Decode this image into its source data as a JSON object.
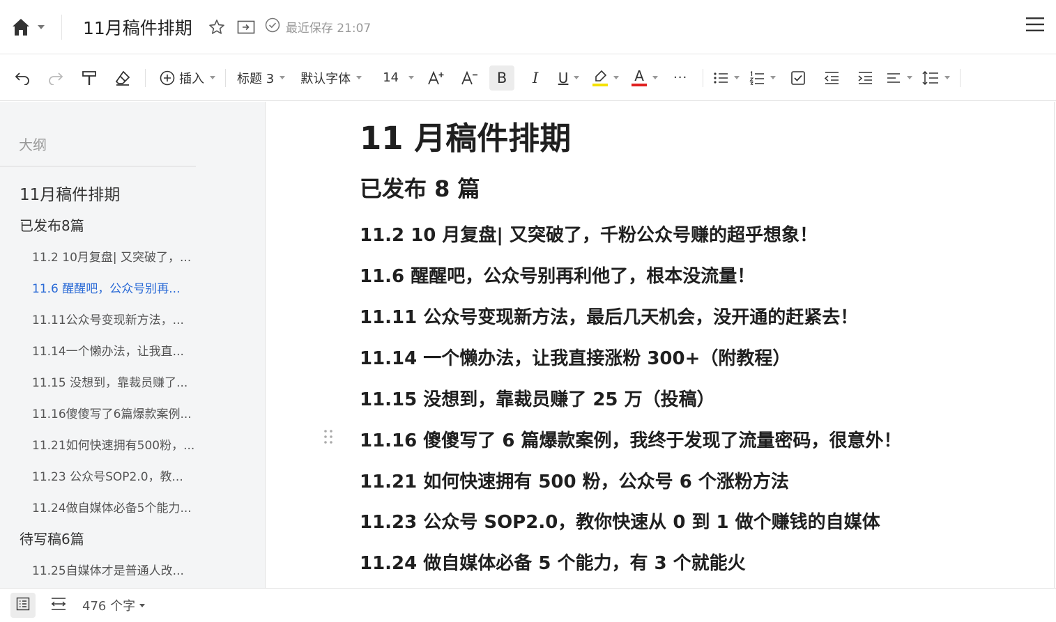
{
  "titlebar": {
    "doc_title": "11月稿件排期",
    "save_status": "最近保存 21:07"
  },
  "toolbar": {
    "insert_label": "插入",
    "heading_style": "标题 3",
    "font_family": "默认字体",
    "font_size": "14",
    "bold_glyph": "B",
    "italic_glyph": "I",
    "underline_glyph": "U",
    "font_color_glyph": "A",
    "more_glyph": "···",
    "highlight_color": "#f5e100",
    "font_color": "#e02020"
  },
  "sidebar": {
    "outline_label": "大纲",
    "items": [
      {
        "text": "11月稿件排期",
        "level": 1
      },
      {
        "text": "已发布8篇",
        "level": 2
      },
      {
        "text": "11.2  10月复盘|  又突破了，...",
        "level": 3
      },
      {
        "text": "11.6  醒醒吧，公众号别再...",
        "level": 3,
        "active": true
      },
      {
        "text": "11.11公众号变现新方法，...",
        "level": 3
      },
      {
        "text": "11.14一个懒办法，让我直...",
        "level": 3
      },
      {
        "text": "11.15  没想到，靠裁员赚了...",
        "level": 3
      },
      {
        "text": "11.16傻傻写了6篇爆款案例...",
        "level": 3
      },
      {
        "text": "11.21如何快速拥有500粉，...",
        "level": 3
      },
      {
        "text": "11.23  公众号SOP2.0，教...",
        "level": 3
      },
      {
        "text": "11.24做自媒体必备5个能力...",
        "level": 3
      },
      {
        "text": "待写稿6篇",
        "level": 2
      },
      {
        "text": "11.25自媒体才是普通人改...",
        "level": 3
      }
    ]
  },
  "editor": {
    "lines": [
      {
        "text": "11 月稿件排期",
        "level": 1
      },
      {
        "text": "已发布 8 篇",
        "level": 2
      },
      {
        "text": "11.2 10 月复盘| 又突破了，千粉公众号赚的超乎想象！",
        "level": 3
      },
      {
        "text": "11.6 醒醒吧，公众号别再利他了，根本没流量！",
        "level": 3
      },
      {
        "text": "11.11 公众号变现新方法，最后几天机会，没开通的赶紧去！",
        "level": 3
      },
      {
        "text": "11.14 一个懒办法，让我直接涨粉 300+（附教程）",
        "level": 3
      },
      {
        "text": "11.15 没想到，靠裁员赚了 25 万（投稿）",
        "level": 3
      },
      {
        "text": "11.16 傻傻写了 6 篇爆款案例，我终于发现了流量密码，很意外！",
        "level": 3
      },
      {
        "text": "11.21 如何快速拥有 500 粉，公众号 6 个涨粉方法",
        "level": 3
      },
      {
        "text": "11.23 公众号 SOP2.0，教你快速从 0 到 1 做个赚钱的自媒体",
        "level": 3
      },
      {
        "text": "11.24 做自媒体必备 5 个能力，有 3 个就能火",
        "level": 3
      }
    ]
  },
  "statusbar": {
    "word_count": "476 个字"
  }
}
